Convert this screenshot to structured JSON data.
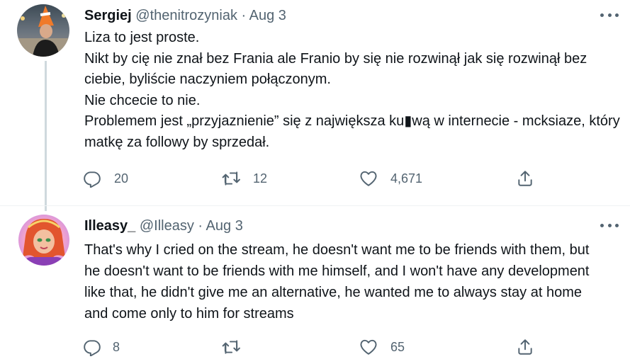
{
  "tweets": [
    {
      "name": "Sergiej",
      "handle": "@thenitrozyniak",
      "separator": "·",
      "date": "Aug 3",
      "lines": [
        "Liza to jest proste.",
        "Nikt by cię nie znał bez Frania ale Franio by się nie rozwinął jak się rozwinął bez ciebie, byliście naczyniem połączonym.",
        "Nie chcecie to nie.",
        "Problemem jest „przyjaznienie” się z największa ku▮wą w internecie - mcksiaze, który matkę za followy by sprzedał."
      ],
      "replies": "20",
      "retweets": "12",
      "likes": "4,671"
    },
    {
      "name": "Illeasy_",
      "handle": "@Illeasy",
      "separator": "·",
      "date": "Aug 3",
      "lines": [
        "That's why I cried on the stream, he doesn't want me to be friends with them, but he doesn't want to be friends with me himself, and I won't have any development like that, he didn't give me an alternative, he wanted me to always stay at home and come only to him for streams"
      ],
      "replies": "8",
      "retweets": "",
      "likes": "65"
    }
  ],
  "icons": {
    "reply": "reply-icon",
    "retweet": "retweet-icon",
    "like": "like-icon",
    "share": "share-icon",
    "more": "more-icon"
  },
  "colors": {
    "text": "#0f1419",
    "secondary": "#536471",
    "thread_line": "#cfd9de",
    "divider": "#eff3f4"
  }
}
